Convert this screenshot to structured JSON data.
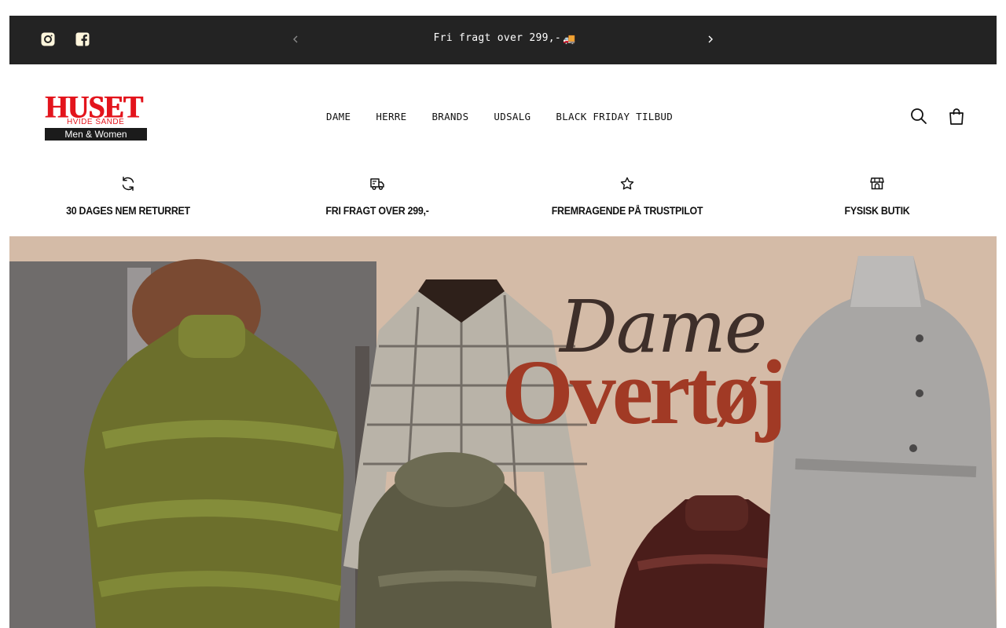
{
  "announcement": {
    "text": "Fri fragt over 299,-",
    "emoji": "🚚",
    "prev_icon": "chevron-left-icon",
    "next_icon": "chevron-right-icon"
  },
  "social": {
    "items": [
      {
        "icon": "instagram-icon"
      },
      {
        "icon": "facebook-icon"
      }
    ]
  },
  "logo": {
    "title": "HUSET",
    "subtitle": "HVIDE SANDE",
    "tagline": "Men & Women"
  },
  "nav": {
    "items": [
      {
        "label": "DAME"
      },
      {
        "label": "HERRE"
      },
      {
        "label": "BRANDS"
      },
      {
        "label": "UDSALG"
      },
      {
        "label": "BLACK FRIDAY TILBUD"
      }
    ]
  },
  "header_icons": [
    {
      "icon": "search-icon"
    },
    {
      "icon": "shopping-bag-icon"
    }
  ],
  "usps": [
    {
      "icon": "refresh-icon",
      "label": "30 DAGES NEM RETURRET"
    },
    {
      "icon": "delivery-truck-icon",
      "label": "FRI FRAGT OVER 299,-"
    },
    {
      "icon": "star-icon",
      "label": "FREMRAGENDE PÅ TRUSTPILOT"
    },
    {
      "icon": "store-icon",
      "label": "FYSISK BUTIK"
    }
  ],
  "hero": {
    "title_script": "Dame",
    "title_main": "Overtøj"
  },
  "colors": {
    "announcement_bg": "#232323",
    "logo_red": "#e3141c",
    "hero_bg": "#d2b8a4",
    "hero_title_red": "#a13a25"
  }
}
